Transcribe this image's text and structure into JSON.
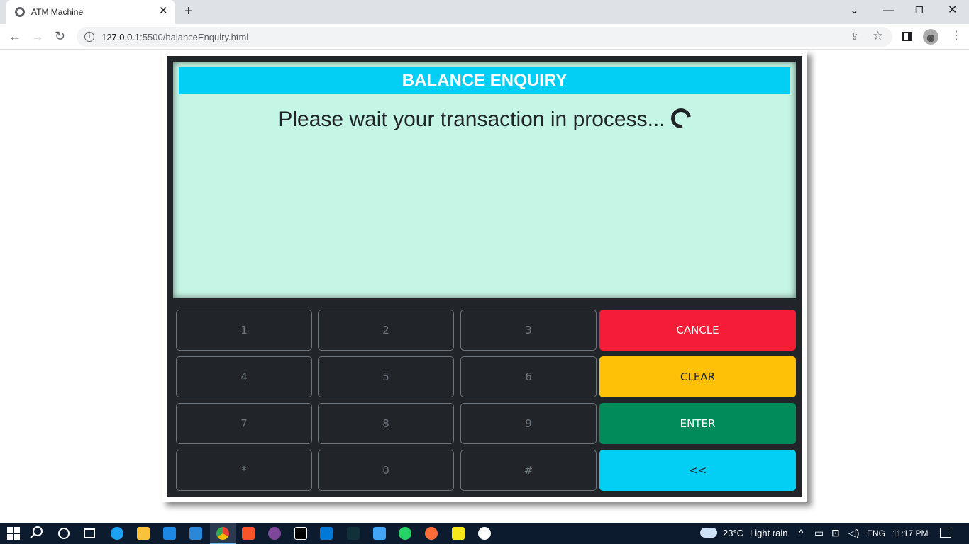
{
  "browser": {
    "tab_title": "ATM Machine",
    "tab_close": "✕",
    "new_tab": "+",
    "url_host": "127.0.0.1",
    "url_path": ":5500/balanceEnquiry.html",
    "back": "←",
    "forward": "→",
    "reload": "↻",
    "info": "i",
    "menu": "⋮",
    "window_controls": {
      "chevron": "⌄",
      "minimize": "—",
      "maximize": "❐",
      "close": "✕"
    }
  },
  "atm": {
    "header": "BALANCE ENQUIRY",
    "status": "Please wait your transaction in process...",
    "keys": [
      "1",
      "2",
      "3",
      "4",
      "5",
      "6",
      "7",
      "8",
      "9",
      "*",
      "0",
      "#"
    ],
    "actions": {
      "cancel": "CANCLE",
      "clear": "CLEAR",
      "enter": "ENTER",
      "back": "<<"
    },
    "colors": {
      "header": "#03cff5",
      "screen": "#c5f5e4",
      "cancel": "#f41c36",
      "clear": "#ffc107",
      "enter": "#028b5a",
      "back": "#03cff5"
    }
  },
  "taskbar": {
    "weather_temp": "23°C",
    "weather_desc": "Light rain",
    "language": "ENG",
    "time": "11:17 PM",
    "tray_chevron": "^",
    "apps": [
      "edge-icon",
      "file-explorer-icon",
      "store-icon",
      "mail-icon",
      "chrome-icon",
      "brave-icon",
      "tor-icon",
      "intellij-icon",
      "vscode-icon",
      "inkscape-icon",
      "flutter-icon",
      "whatsapp-icon",
      "postman-icon",
      "sticky-notes-icon",
      "github-icon"
    ]
  }
}
